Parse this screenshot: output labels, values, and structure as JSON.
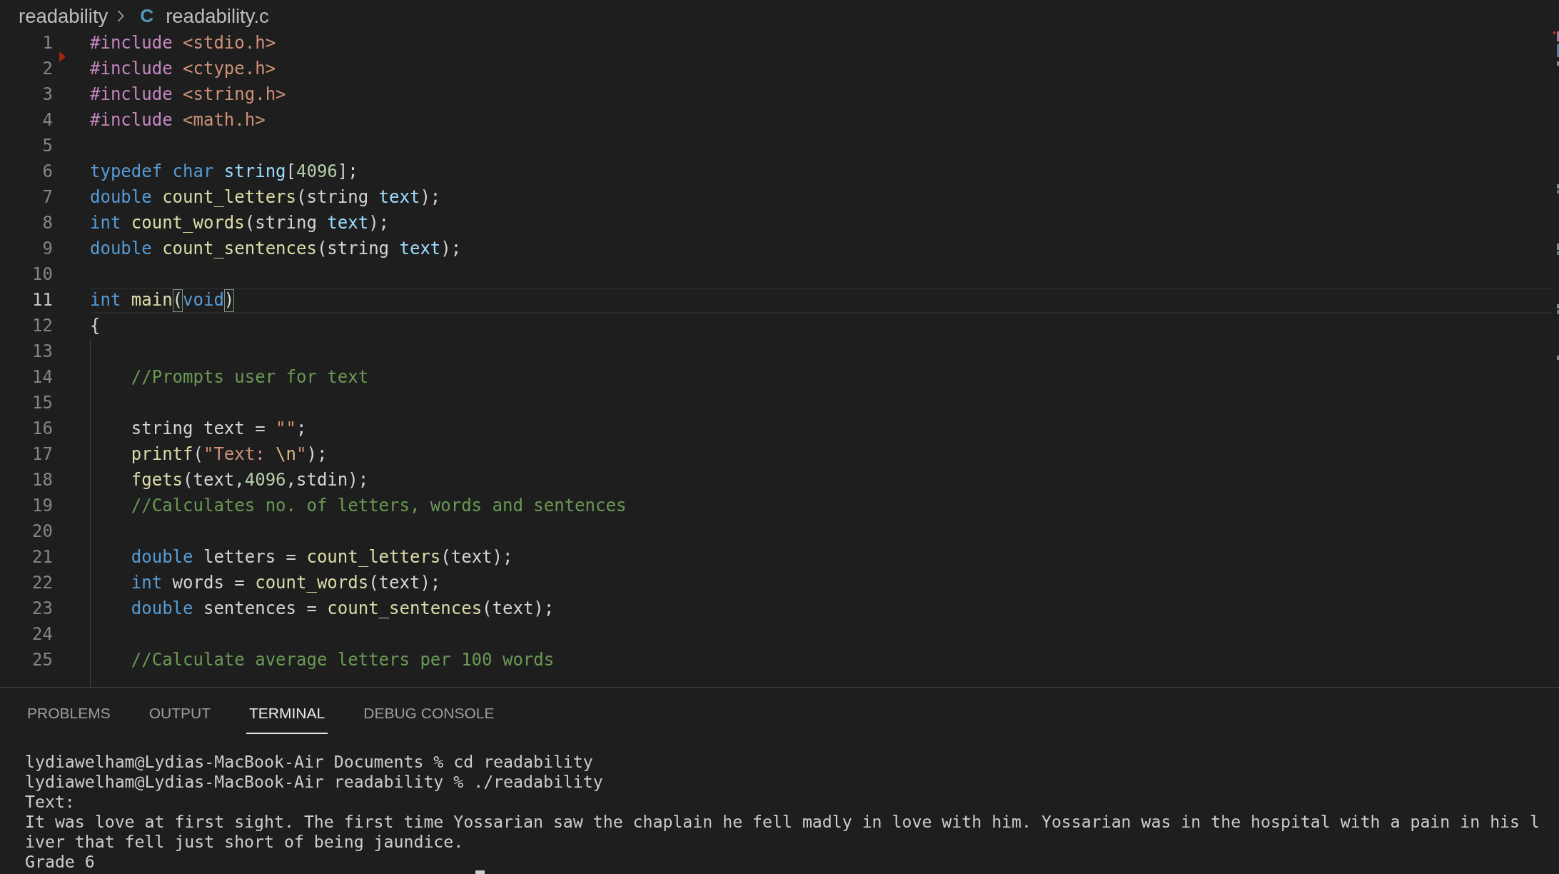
{
  "breadcrumb": [
    {
      "kind": "folder",
      "label": "readability"
    },
    {
      "kind": "file",
      "icon": "C",
      "label": "readability.c"
    }
  ],
  "editor": {
    "lines": [
      {
        "number": "1",
        "current": false,
        "deleted_above": false,
        "tokens": [
          {
            "kind": "directive",
            "text": "#include"
          },
          {
            "kind": "header",
            "text": " <stdio.h>"
          }
        ]
      },
      {
        "number": "2",
        "current": false,
        "deleted_above": true,
        "tokens": [
          {
            "kind": "directive",
            "text": "#include"
          },
          {
            "kind": "header",
            "text": " <ctype.h>"
          }
        ]
      },
      {
        "number": "3",
        "current": false,
        "deleted_above": false,
        "tokens": [
          {
            "kind": "directive",
            "text": "#include"
          },
          {
            "kind": "header",
            "text": " <string.h>"
          }
        ]
      },
      {
        "number": "4",
        "current": false,
        "deleted_above": false,
        "tokens": [
          {
            "kind": "directive",
            "text": "#include"
          },
          {
            "kind": "header",
            "text": " <math.h>"
          }
        ]
      },
      {
        "number": "5",
        "current": false,
        "deleted_above": false
      },
      {
        "number": "6",
        "current": false,
        "deleted_above": false,
        "tokens": [
          {
            "kind": "keyword",
            "text": "typedef char"
          },
          {
            "kind": "variable",
            "text": " string"
          },
          {
            "kind": "plain",
            "text": "["
          },
          {
            "kind": "number",
            "text": "4096"
          },
          {
            "kind": "plain",
            "text": "];"
          }
        ]
      },
      {
        "number": "7",
        "current": false,
        "deleted_above": false,
        "tokens": [
          {
            "kind": "keyword",
            "text": "double"
          },
          {
            "kind": "function",
            "text": " count_letters"
          },
          {
            "kind": "plain",
            "text": "(string "
          },
          {
            "kind": "variable",
            "text": "text"
          },
          {
            "kind": "plain",
            "text": ");"
          }
        ]
      },
      {
        "number": "8",
        "current": false,
        "deleted_above": false,
        "tokens": [
          {
            "kind": "keyword",
            "text": "int"
          },
          {
            "kind": "function",
            "text": " count_words"
          },
          {
            "kind": "plain",
            "text": "(string "
          },
          {
            "kind": "variable",
            "text": "text"
          },
          {
            "kind": "plain",
            "text": ");"
          }
        ]
      },
      {
        "number": "9",
        "current": false,
        "deleted_above": false,
        "tokens": [
          {
            "kind": "keyword",
            "text": "double"
          },
          {
            "kind": "function",
            "text": " count_sentences"
          },
          {
            "kind": "plain",
            "text": "(string "
          },
          {
            "kind": "variable",
            "text": "text"
          },
          {
            "kind": "plain",
            "text": ");"
          }
        ]
      },
      {
        "number": "10",
        "current": false,
        "deleted_above": false
      },
      {
        "number": "11",
        "current": true,
        "deleted_above": false,
        "tokens": [
          {
            "kind": "keyword",
            "text": "int"
          },
          {
            "kind": "function",
            "text": " main"
          },
          {
            "kind": "bracket_match",
            "text": "("
          },
          {
            "kind": "keyword",
            "text": "void"
          },
          {
            "kind": "bracket_match",
            "text": ")"
          }
        ]
      },
      {
        "number": "12",
        "current": false,
        "deleted_above": false,
        "tokens": [
          {
            "kind": "plain",
            "text": "{"
          }
        ],
        "children": [
          {
            "number": "13",
            "current": false,
            "deleted_above": false
          },
          {
            "number": "14",
            "current": false,
            "deleted_above": false,
            "tokens": [
              {
                "kind": "comment",
                "text": "//Prompts user for text"
              }
            ]
          },
          {
            "number": "15",
            "current": false,
            "deleted_above": false
          },
          {
            "number": "16",
            "current": false,
            "deleted_above": false,
            "tokens": [
              {
                "kind": "plain",
                "text": "string text = "
              },
              {
                "kind": "string",
                "text": "\"\""
              },
              {
                "kind": "plain",
                "text": ";"
              }
            ]
          },
          {
            "number": "17",
            "current": false,
            "deleted_above": false,
            "tokens": [
              {
                "kind": "function",
                "text": "printf"
              },
              {
                "kind": "plain",
                "text": "("
              },
              {
                "kind": "string",
                "text": "\"Text: "
              },
              {
                "kind": "escape",
                "text": "\\n"
              },
              {
                "kind": "string",
                "text": "\""
              },
              {
                "kind": "plain",
                "text": ");"
              }
            ]
          },
          {
            "number": "18",
            "current": false,
            "deleted_above": false,
            "tokens": [
              {
                "kind": "function",
                "text": "fgets"
              },
              {
                "kind": "plain",
                "text": "(text,"
              },
              {
                "kind": "number",
                "text": "4096"
              },
              {
                "kind": "plain",
                "text": ",stdin);"
              }
            ]
          },
          {
            "number": "19",
            "current": false,
            "deleted_above": false,
            "tokens": [
              {
                "kind": "comment",
                "text": "//Calculates no. of letters, words and sentences"
              }
            ]
          },
          {
            "number": "20",
            "current": false,
            "deleted_above": false
          },
          {
            "number": "21",
            "current": false,
            "deleted_above": false,
            "tokens": [
              {
                "kind": "keyword",
                "text": "double"
              },
              {
                "kind": "plain",
                "text": " letters = "
              },
              {
                "kind": "function",
                "text": "count_letters"
              },
              {
                "kind": "plain",
                "text": "(text);"
              }
            ]
          },
          {
            "number": "22",
            "current": false,
            "deleted_above": false,
            "tokens": [
              {
                "kind": "keyword",
                "text": "int"
              },
              {
                "kind": "plain",
                "text": " words = "
              },
              {
                "kind": "function",
                "text": "count_words"
              },
              {
                "kind": "plain",
                "text": "(text);"
              }
            ]
          },
          {
            "number": "23",
            "current": false,
            "deleted_above": false,
            "tokens": [
              {
                "kind": "keyword",
                "text": "double"
              },
              {
                "kind": "plain",
                "text": " sentences = "
              },
              {
                "kind": "function",
                "text": "count_sentences"
              },
              {
                "kind": "plain",
                "text": "(text);"
              }
            ]
          },
          {
            "number": "24",
            "current": false,
            "deleted_above": false
          },
          {
            "number": "25",
            "current": false,
            "deleted_above": false,
            "tokens": [
              {
                "kind": "comment",
                "text": "//Calculate average letters per 100 words"
              }
            ]
          }
        ]
      }
    ]
  },
  "panel": {
    "tabs": [
      {
        "label": "PROBLEMS",
        "selected": false
      },
      {
        "label": "OUTPUT",
        "selected": false
      },
      {
        "label": "TERMINAL",
        "selected": true
      },
      {
        "label": "DEBUG CONSOLE",
        "selected": false
      }
    ],
    "terminal_lines": [
      "lydiawelham@Lydias-MacBook-Air Documents % cd readability",
      "lydiawelham@Lydias-MacBook-Air readability % ./readability",
      "Text:",
      "It was love at first sight. The first time Yossarian saw the chaplain he fell madly in love with him. Yossarian was in the hospital with a pain in his l",
      "iver that fell just short of being jaundice.",
      "Grade 6"
    ]
  }
}
